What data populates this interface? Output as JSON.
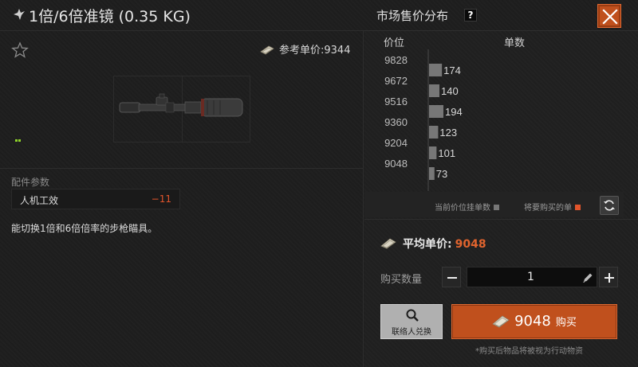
{
  "header": {
    "item_title": "1倍/6倍准镜 (0.35 KG)",
    "market_title": "市场售价分布",
    "help_label": "?"
  },
  "item": {
    "ref_price_label": "参考单价:9344",
    "params_label": "配件参数",
    "param": {
      "name": "人机工效",
      "value": "−11"
    },
    "description": "能切换1倍和6倍倍率的步枪瞄具。"
  },
  "market": {
    "col_price": "价位",
    "col_count": "单数",
    "legend_current": "当前价位挂单数",
    "legend_buy": "将要购买的单"
  },
  "chart_data": {
    "type": "bar",
    "orientation": "horizontal",
    "categories": [
      "9828",
      "9672",
      "9516",
      "9360",
      "9204",
      "9048"
    ],
    "values": [
      null,
      174,
      140,
      194,
      123,
      101,
      73
    ],
    "value_labels": [
      "174",
      "140",
      "194",
      "123",
      "101",
      "73"
    ],
    "bars": [
      {
        "price_slot": 0.5,
        "value": 174
      },
      {
        "price_slot": 1.5,
        "value": 140
      },
      {
        "price_slot": 2.5,
        "value": 194
      },
      {
        "price_slot": 3.5,
        "value": 123
      },
      {
        "price_slot": 4.5,
        "value": 101
      },
      {
        "price_slot": 5.5,
        "value": 73
      }
    ],
    "xlabel": "单数",
    "ylabel": "价位",
    "colors": {
      "current": "#777777",
      "buy": "#e1542b"
    }
  },
  "purchase": {
    "avg_price_label": "平均单价:",
    "avg_price_value": "9048",
    "qty_label": "购买数量",
    "qty_value": "1",
    "contact_label": "联络人兑换",
    "buy_amount": "9048",
    "buy_label": "购买",
    "note": "*购买后物品将被视为行动物资"
  },
  "colors": {
    "accent": "#c0501d",
    "price_orange": "#e1642e",
    "negative": "#e1542b",
    "grade": "#8fd42a"
  },
  "icons": [
    "bird-icon",
    "help-icon",
    "close-icon",
    "star-icon",
    "money-icon",
    "refresh-icon",
    "minus-icon",
    "plus-icon",
    "pencil-icon",
    "search-icon"
  ]
}
